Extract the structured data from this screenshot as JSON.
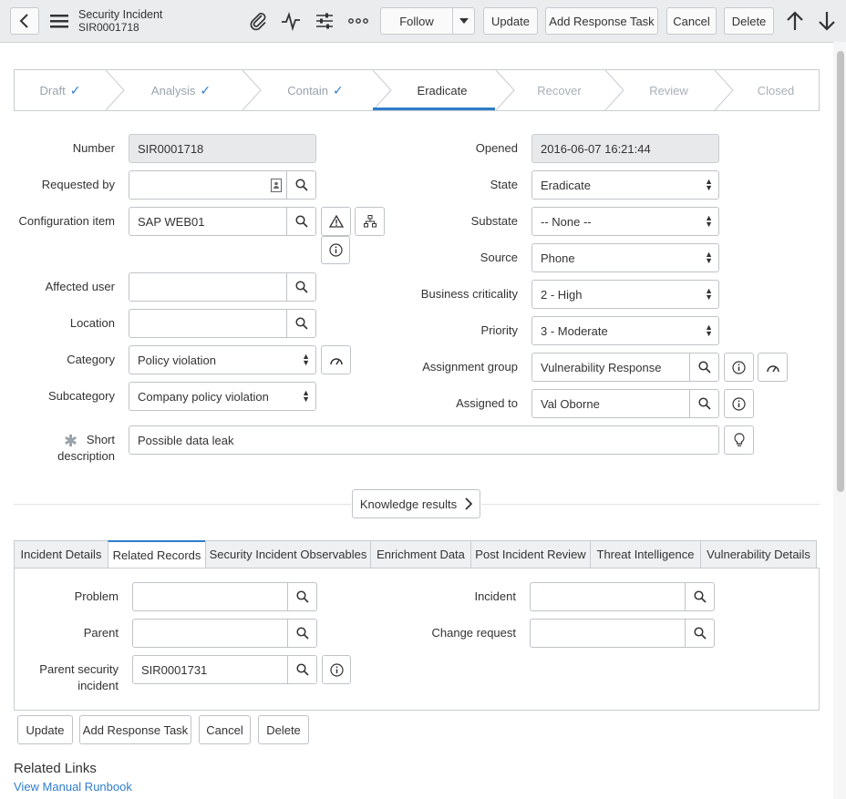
{
  "header": {
    "title": "Security Incident",
    "number": "SIR0001718",
    "buttons": {
      "follow": "Follow",
      "update": "Update",
      "add_response_task": "Add Response Task",
      "cancel": "Cancel",
      "delete": "Delete"
    }
  },
  "process_flow": {
    "stages": [
      {
        "label": "Draft",
        "status": "complete"
      },
      {
        "label": "Analysis",
        "status": "complete"
      },
      {
        "label": "Contain",
        "status": "complete"
      },
      {
        "label": "Eradicate",
        "status": "current"
      },
      {
        "label": "Recover",
        "status": "future"
      },
      {
        "label": "Review",
        "status": "future"
      },
      {
        "label": "Closed",
        "status": "future"
      }
    ]
  },
  "form": {
    "number": {
      "label": "Number",
      "value": "SIR0001718"
    },
    "requested_by": {
      "label": "Requested by",
      "value": ""
    },
    "configuration_item": {
      "label": "Configuration item",
      "value": "SAP WEB01"
    },
    "affected_user": {
      "label": "Affected user",
      "value": ""
    },
    "location": {
      "label": "Location",
      "value": ""
    },
    "category": {
      "label": "Category",
      "value": "Policy violation"
    },
    "subcategory": {
      "label": "Subcategory",
      "value": "Company policy violation"
    },
    "short_description": {
      "label_line1": "Short",
      "label_line2": "description",
      "value": "Possible data leak"
    },
    "opened": {
      "label": "Opened",
      "value": "2016-06-07 16:21:44"
    },
    "state": {
      "label": "State",
      "value": "Eradicate"
    },
    "substate": {
      "label": "Substate",
      "value": "-- None --"
    },
    "source": {
      "label": "Source",
      "value": "Phone"
    },
    "business_criticality": {
      "label": "Business criticality",
      "value": "2 - High"
    },
    "priority": {
      "label": "Priority",
      "value": "3 - Moderate"
    },
    "assignment_group": {
      "label": "Assignment group",
      "value": "Vulnerability Response"
    },
    "assigned_to": {
      "label": "Assigned to",
      "value": "Val Oborne"
    }
  },
  "knowledge_button": "Knowledge results",
  "tabs": [
    {
      "label": "Incident Details",
      "active": false
    },
    {
      "label": "Related Records",
      "active": true
    },
    {
      "label": "Security Incident Observables",
      "active": false
    },
    {
      "label": "Enrichment Data",
      "active": false
    },
    {
      "label": "Post Incident Review",
      "active": false
    },
    {
      "label": "Threat Intelligence",
      "active": false
    },
    {
      "label": "Vulnerability Details",
      "active": false
    }
  ],
  "related_records": {
    "problem": {
      "label": "Problem",
      "value": ""
    },
    "parent": {
      "label": "Parent",
      "value": ""
    },
    "parent_security_incident": {
      "label_line1": "Parent security",
      "label_line2": "incident",
      "value": "SIR0001731"
    },
    "incident": {
      "label": "Incident",
      "value": ""
    },
    "change_request": {
      "label": "Change request",
      "value": ""
    }
  },
  "bottom_buttons": {
    "update": "Update",
    "add_response_task": "Add Response Task",
    "cancel": "Cancel",
    "delete": "Delete"
  },
  "related_links": {
    "title": "Related Links",
    "links": [
      "View Manual Runbook"
    ]
  },
  "colors": {
    "accent": "#2f7dc9",
    "header_bg": "#eaecee"
  }
}
